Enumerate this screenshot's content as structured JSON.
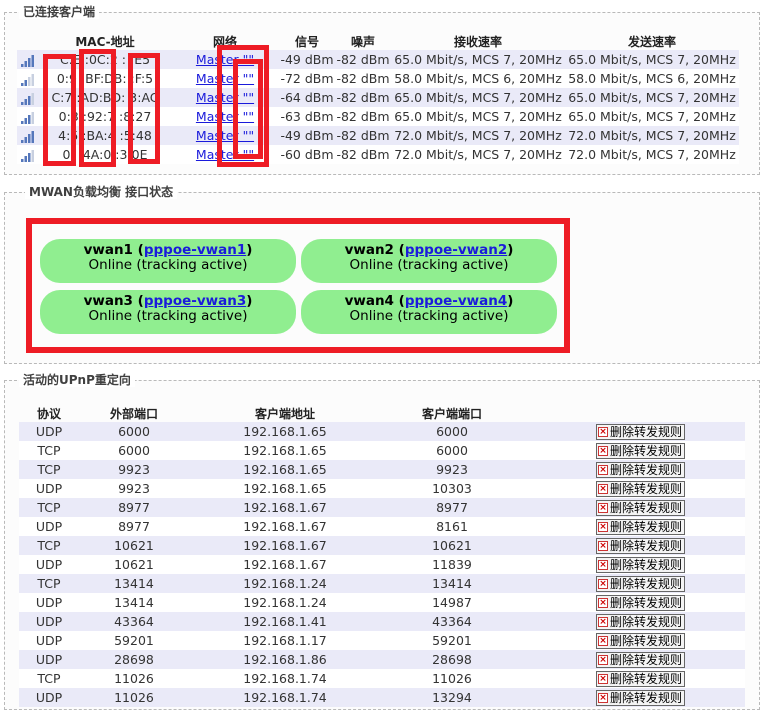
{
  "clients": {
    "legend": "已连接客户端",
    "headers": {
      "mac": "MAC-地址",
      "network": "网络",
      "signal": "信号",
      "noise": "噪声",
      "rx": "接收速率",
      "tx": "发送速率"
    },
    "rows": [
      {
        "mac": "C:E  :0C:2  :  :E5",
        "network": "Master \"\"",
        "signal": "-49 dBm",
        "noise": "-82 dBm",
        "rx": "65.0 Mbit/s, MCS 7, 20MHz",
        "tx": "65.0 Mbit/s, MCS 7, 20MHz",
        "level": 4
      },
      {
        "mac": "0:9  :BF:DB:  :F:5",
        "network": "Master \"\"",
        "signal": "-72 dBm",
        "noise": "-82 dBm",
        "rx": "58.0 Mbit/s, MCS 6, 20MHz",
        "tx": "58.0 Mbit/s, MCS 6, 20MHz",
        "level": 2
      },
      {
        "mac": "C:7  :AD:BD:  3:AC",
        "network": "Master \"\"",
        "signal": "-64 dBm",
        "noise": "-82 dBm",
        "rx": "65.0 Mbit/s, MCS 7, 20MHz",
        "tx": "65.0 Mbit/s, MCS 7, 20MHz",
        "level": 3
      },
      {
        "mac": "0:3  :92:7  :8:27",
        "network": "Master \"\"",
        "signal": "-63 dBm",
        "noise": "-82 dBm",
        "rx": "65.0 Mbit/s, MCS 7, 20MHz",
        "tx": "65.0 Mbit/s, MCS 7, 20MHz",
        "level": 3
      },
      {
        "mac": "4:5  :BA:4  :5:48",
        "network": "Master \"\"",
        "signal": "-49 dBm",
        "noise": "-82 dBm",
        "rx": "72.0 Mbit/s, MCS 7, 20MHz",
        "tx": "72.0 Mbit/s, MCS 7, 20MHz",
        "level": 4
      },
      {
        "mac": "0:  :4A:0  :3:0E",
        "network": "Master \"\"",
        "signal": "-60 dBm",
        "noise": "-82 dBm",
        "rx": "72.0 Mbit/s, MCS 7, 20MHz",
        "tx": "72.0 Mbit/s, MCS 7, 20MHz",
        "level": 3
      }
    ]
  },
  "mwan": {
    "legend": "MWAN负载均衡 接口状态",
    "interfaces": [
      {
        "name": "vwan1",
        "link": "pppoe-vwan1",
        "status": "Online (tracking active)"
      },
      {
        "name": "vwan2",
        "link": "pppoe-vwan2",
        "status": "Online (tracking active)"
      },
      {
        "name": "vwan3",
        "link": "pppoe-vwan3",
        "status": "Online (tracking active)"
      },
      {
        "name": "vwan4",
        "link": "pppoe-vwan4",
        "status": "Online (tracking active)"
      }
    ]
  },
  "upnp": {
    "legend": "活动的UPnP重定向",
    "headers": {
      "proto": "协议",
      "ext": "外部端口",
      "addr": "客户端地址",
      "port": "客户端端口"
    },
    "delete_label": "删除转发规则",
    "rows": [
      {
        "proto": "UDP",
        "ext": "6000",
        "addr": "192.168.1.65",
        "port": "6000"
      },
      {
        "proto": "TCP",
        "ext": "6000",
        "addr": "192.168.1.65",
        "port": "6000"
      },
      {
        "proto": "TCP",
        "ext": "9923",
        "addr": "192.168.1.65",
        "port": "9923"
      },
      {
        "proto": "UDP",
        "ext": "9923",
        "addr": "192.168.1.65",
        "port": "10303"
      },
      {
        "proto": "TCP",
        "ext": "8977",
        "addr": "192.168.1.67",
        "port": "8977"
      },
      {
        "proto": "UDP",
        "ext": "8977",
        "addr": "192.168.1.67",
        "port": "8161"
      },
      {
        "proto": "TCP",
        "ext": "10621",
        "addr": "192.168.1.67",
        "port": "10621"
      },
      {
        "proto": "UDP",
        "ext": "10621",
        "addr": "192.168.1.67",
        "port": "11839"
      },
      {
        "proto": "TCP",
        "ext": "13414",
        "addr": "192.168.1.24",
        "port": "13414"
      },
      {
        "proto": "UDP",
        "ext": "13414",
        "addr": "192.168.1.24",
        "port": "14987"
      },
      {
        "proto": "UDP",
        "ext": "43364",
        "addr": "192.168.1.41",
        "port": "43364"
      },
      {
        "proto": "UDP",
        "ext": "59201",
        "addr": "192.168.1.17",
        "port": "59201"
      },
      {
        "proto": "UDP",
        "ext": "28698",
        "addr": "192.168.1.86",
        "port": "28698"
      },
      {
        "proto": "TCP",
        "ext": "11026",
        "addr": "192.168.1.74",
        "port": "11026"
      },
      {
        "proto": "UDP",
        "ext": "11026",
        "addr": "192.168.1.74",
        "port": "13294"
      }
    ]
  },
  "colors": {
    "online": "#90ee90",
    "annotation": "#ee1c25",
    "row_alt": "#eaeaf8",
    "link": "#1a1adb"
  }
}
